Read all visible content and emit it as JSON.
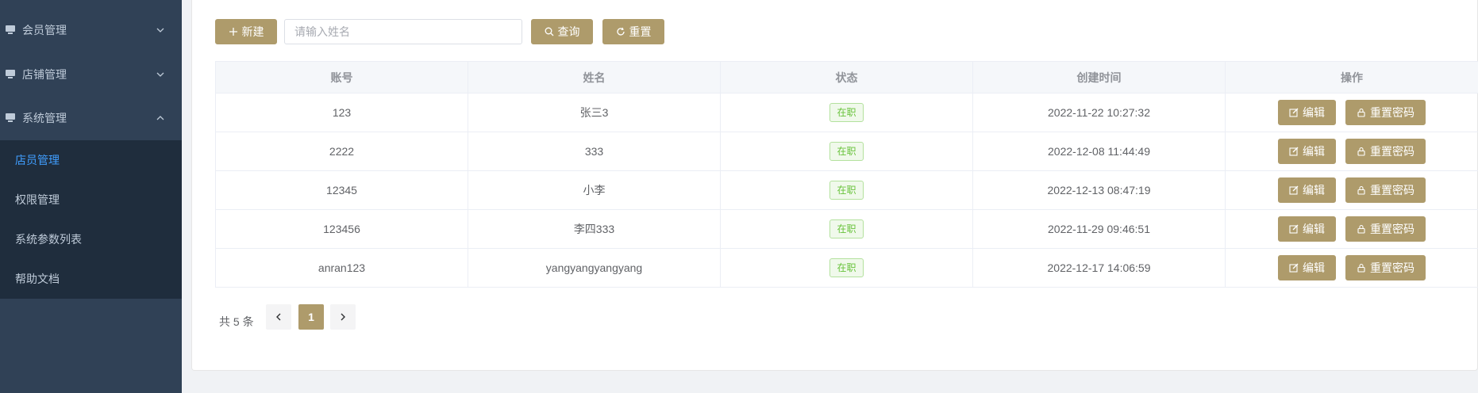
{
  "sidebar": {
    "groups": [
      {
        "label": "会员管理",
        "expanded": false
      },
      {
        "label": "店铺管理",
        "expanded": false
      },
      {
        "label": "系统管理",
        "expanded": true
      }
    ],
    "sub_items": [
      {
        "label": "店员管理",
        "active": true
      },
      {
        "label": "权限管理",
        "active": false
      },
      {
        "label": "系统参数列表",
        "active": false
      },
      {
        "label": "帮助文档",
        "active": false
      }
    ]
  },
  "toolbar": {
    "new_label": "新建",
    "search_placeholder": "请输入姓名",
    "search_value": "",
    "query_label": "查询",
    "reset_label": "重置"
  },
  "table": {
    "headers": [
      "账号",
      "姓名",
      "状态",
      "创建时间",
      "操作"
    ],
    "rows": [
      {
        "account": "123",
        "name": "张三3",
        "status": "在职",
        "created": "2022-11-22 10:27:32"
      },
      {
        "account": "2222",
        "name": "333",
        "status": "在职",
        "created": "2022-12-08 11:44:49"
      },
      {
        "account": "12345",
        "name": "小李",
        "status": "在职",
        "created": "2022-12-13 08:47:19"
      },
      {
        "account": "123456",
        "name": "李四333",
        "status": "在职",
        "created": "2022-11-29 09:46:51"
      },
      {
        "account": "anran123",
        "name": "yangyangyangyang",
        "status": "在职",
        "created": "2022-12-17 14:06:59"
      }
    ],
    "actions": {
      "edit_label": "编辑",
      "reset_password_label": "重置密码"
    }
  },
  "pagination": {
    "total_text": "共 5 条",
    "current_page": "1"
  },
  "colors": {
    "accent": "#ae9b6b",
    "sidebar_bg": "#304156",
    "active_link": "#409eff",
    "tag_green": "#67c23a"
  },
  "icons": [
    "monitor-icon",
    "chevron-down-icon",
    "chevron-up-icon",
    "plus-icon",
    "search-icon",
    "refresh-icon",
    "edit-icon",
    "lock-icon",
    "chevron-left-icon",
    "chevron-right-icon"
  ]
}
